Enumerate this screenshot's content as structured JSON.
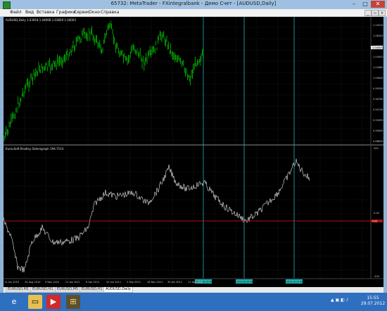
{
  "window": {
    "title": "65732: MetaTrader - FXintegralbank - Демо Счет - [AUDUSD,Daily]",
    "buttons": {
      "minimize": "–",
      "maximize": "□",
      "close": "✕"
    }
  },
  "menu": [
    "Файл",
    "Вид",
    "Вставка",
    "Графики",
    "Сервис",
    "Окно",
    "Справка"
  ],
  "price_chart": {
    "label": "AUDUSD,Daily  1.03918 1.04068 1.03829 1.04003",
    "price_levels": [
      "1.10010",
      "1.08445",
      "1.06480",
      "1.04003",
      "1.02660",
      "1.00845",
      "0.99295",
      "0.96760",
      "0.94745",
      "0.92630",
      "0.90645",
      "0.88830"
    ],
    "current_price": "1.04003",
    "colors": {
      "candles": "#00dd00",
      "background": "#000000"
    }
  },
  "indicator": {
    "label": "ItumuSoft Bradley Siderograph 194.7514",
    "levels": [
      "200",
      "0.00",
      "-200"
    ],
    "zero_marker": "0.00",
    "colors": {
      "line": "#e8e8e8",
      "zero_line": "#b01010"
    }
  },
  "time_axis": [
    "11 Jun 2010",
    "25 Aug 2010",
    "9 Nov 2010",
    "21 Jan 2011",
    "6 Apr 2011",
    "20 Jun 2011",
    "2 Sep 2011",
    "16 Nov 2011",
    "30 Jan 2012",
    "11 Apr 2012"
  ],
  "vertical_markers": [
    {
      "label": "2012.06.15 00:00"
    },
    {
      "label": "2012.09.10 00:00"
    },
    {
      "label": "2012.12.21 00:00"
    }
  ],
  "tabs": [
    "EURUSD,M1",
    "EURUSD,H1",
    "EURUSD,M5",
    "EURUSD,H1",
    "AUDUSD,Daily"
  ],
  "active_tab": "AUDUSD,Daily",
  "taskbar": {
    "icons": [
      "ie-icon",
      "explorer-icon",
      "media-icon",
      "metatrader-icon"
    ],
    "tray": "▲ ▣ ◧ ♪",
    "time": "15:55",
    "date": "29.07.2012"
  }
}
